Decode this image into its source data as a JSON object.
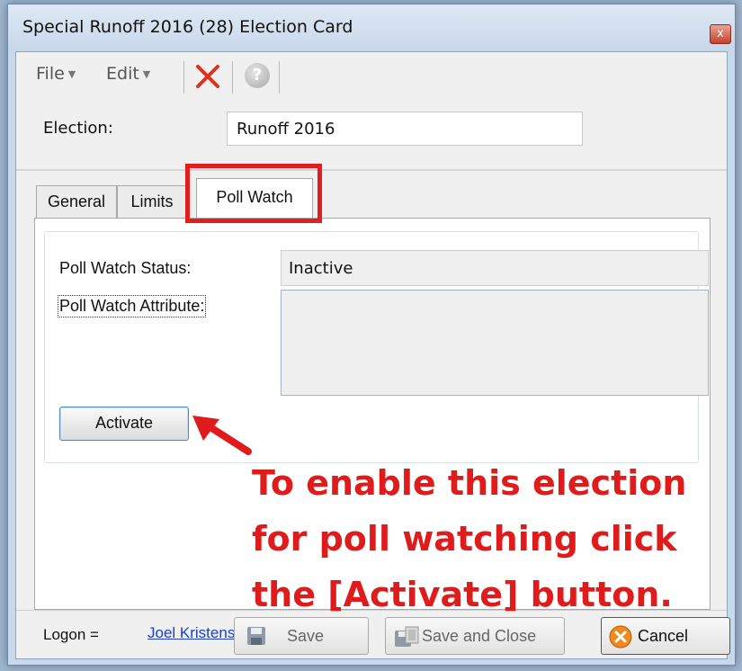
{
  "window": {
    "title": "Special Runoff 2016 (28) Election Card",
    "close_glyph": "x"
  },
  "menu": {
    "file": "File",
    "edit": "Edit",
    "help_glyph": "?"
  },
  "election": {
    "label": "Election:",
    "value": "Runoff 2016"
  },
  "tabs": [
    {
      "label": "General",
      "active": false
    },
    {
      "label": "Limits",
      "active": false
    },
    {
      "label": "Poll Watch",
      "active": true
    }
  ],
  "poll_watch": {
    "status_label": "Poll Watch Status:",
    "status_value": "Inactive",
    "attribute_label": "Poll Watch Attribute:",
    "attribute_value": "",
    "activate_label": "Activate"
  },
  "annotation": {
    "lines": [
      "To enable this election",
      "for poll watching click",
      "the [Activate] button."
    ],
    "color": "#e01b1b"
  },
  "footer": {
    "logon_label": "Logon =",
    "logon_user": "Joel Kristensen",
    "save_label": "Save",
    "save_close_label": "Save and Close",
    "cancel_label": "Cancel"
  },
  "icons": [
    "delete-icon",
    "help-icon",
    "save-icon",
    "save-close-icon",
    "cancel-icon",
    "close-icon"
  ]
}
